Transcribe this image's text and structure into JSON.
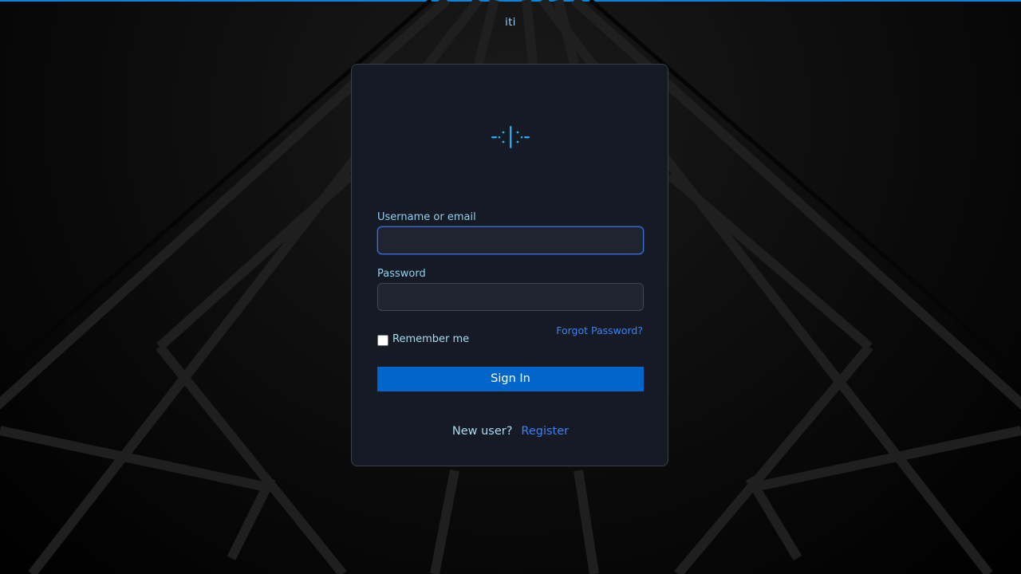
{
  "realm": {
    "name": "iti"
  },
  "logo": {
    "icon": "iti-logo-icon",
    "color": "#29a8f0"
  },
  "form": {
    "username_label": "Username or email",
    "username_value": "",
    "password_label": "Password",
    "password_value": "",
    "remember_label": "Remember me",
    "remember_checked": false,
    "forgot_label": "Forgot Password?",
    "submit_label": "Sign In"
  },
  "register": {
    "prompt": "New user?",
    "link_label": "Register"
  },
  "colors": {
    "accent": "#0a84d8",
    "primary_button": "#0066cc",
    "link": "#3b82f6",
    "label": "#8fd0f0",
    "card_bg": "#151a24"
  }
}
